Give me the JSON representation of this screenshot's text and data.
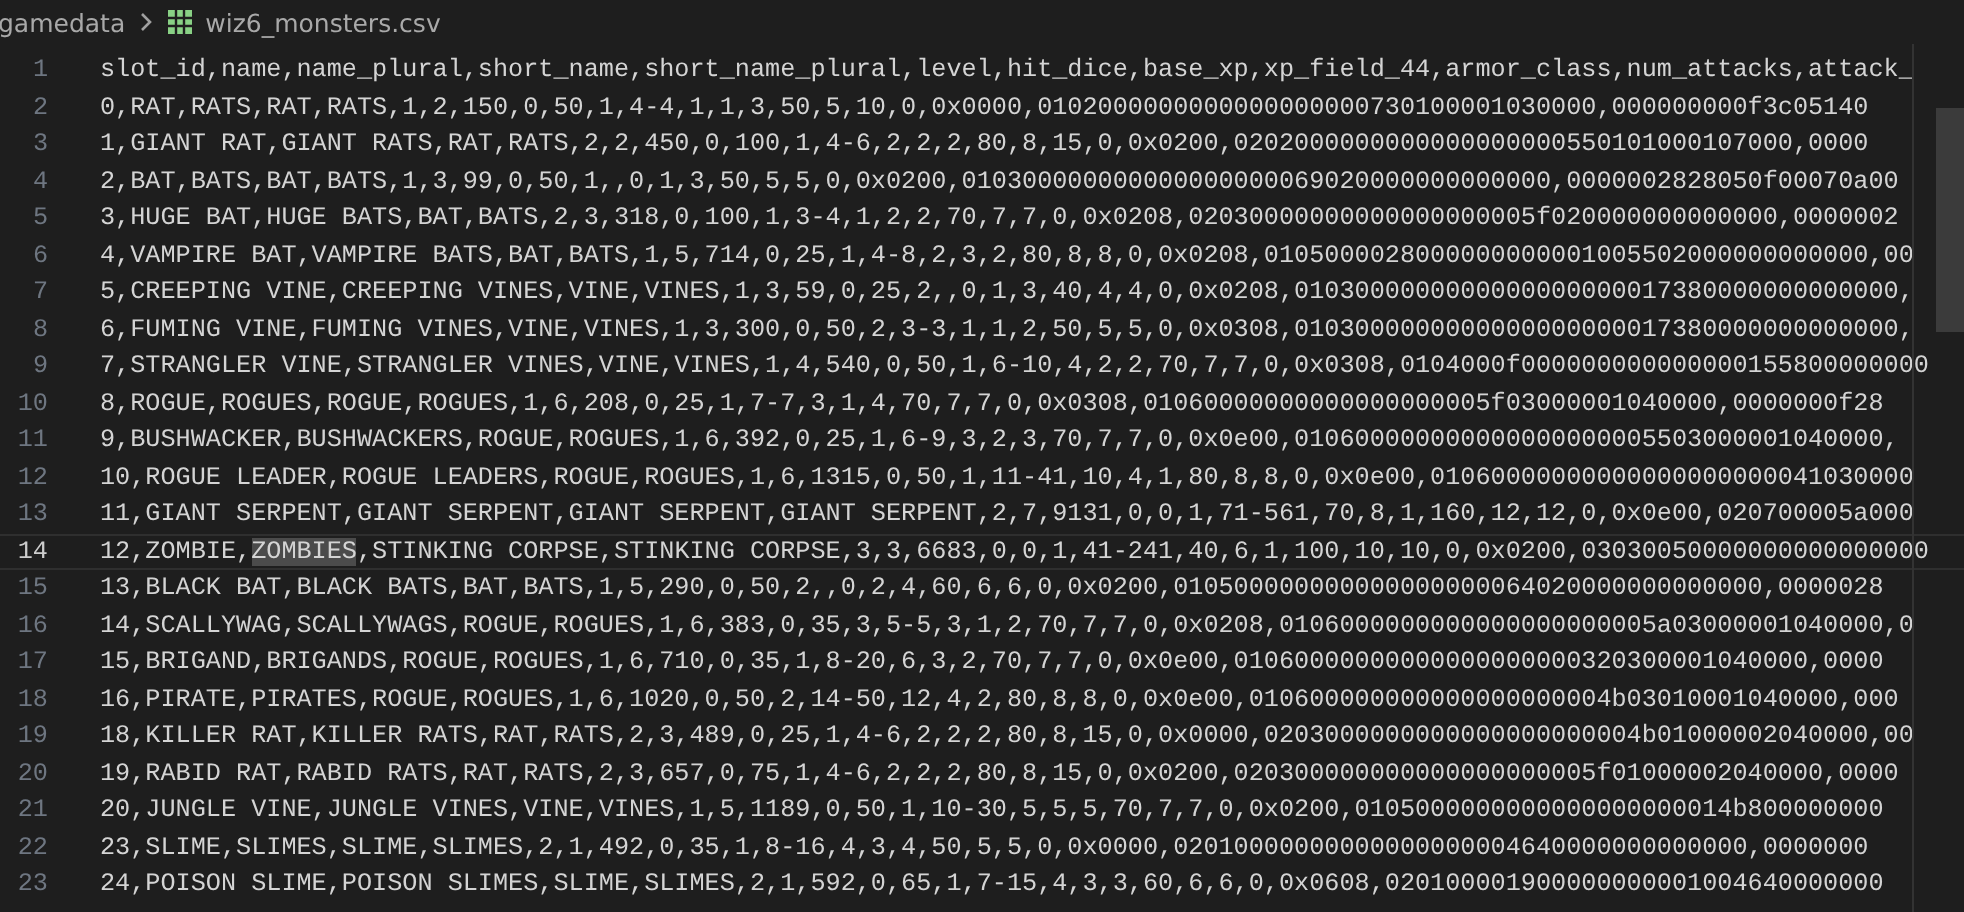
{
  "breadcrumb": {
    "folder": "gamedata",
    "file": "wiz6_monsters.csv"
  },
  "lines": [
    {
      "number": "1",
      "text": "slot_id,name,name_plural,short_name,short_name_plural,level,hit_dice,base_xp,xp_field_44,armor_class,num_attacks,attack_",
      "current": false
    },
    {
      "number": "2",
      "text": "0,RAT,RATS,RAT,RATS,1,2,150,0,50,1,4-4,1,1,3,50,5,10,0,0x0000,0102000000000000000000730100001030000,000000000f3c05140",
      "current": false
    },
    {
      "number": "3",
      "text": "1,GIANT RAT,GIANT RATS,RAT,RATS,2,2,450,0,100,1,4-6,2,2,2,80,8,15,0,0x0200,0202000000000000000000550101000107000,0000",
      "current": false
    },
    {
      "number": "4",
      "text": "2,BAT,BATS,BAT,BATS,1,3,99,0,50,1,,0,1,3,50,5,5,0,0x0200,010300000000000000000069020000000000000,0000002828050f00070a00",
      "current": false
    },
    {
      "number": "5",
      "text": "3,HUGE BAT,HUGE BATS,BAT,BATS,2,3,318,0,100,1,3-4,1,2,2,70,7,7,0,0x0208,02030000000000000000005f020000000000000,0000002",
      "current": false
    },
    {
      "number": "6",
      "text": "4,VAMPIRE BAT,VAMPIRE BATS,BAT,BATS,1,5,714,0,25,1,4-8,2,3,2,80,8,8,0,0x0208,0105000028000000000001005502000000000000,00",
      "current": false
    },
    {
      "number": "7",
      "text": "5,CREEPING VINE,CREEPING VINES,VINE,VINES,1,3,59,0,25,2,,0,1,3,40,4,4,0,0x0208,0103000000000000000000017380000000000000,",
      "current": false
    },
    {
      "number": "8",
      "text": "6,FUMING VINE,FUMING VINES,VINE,VINES,1,3,300,0,50,2,3-3,1,1,2,50,5,5,0,0x0308,0103000000000000000000017380000000000000,",
      "current": false
    },
    {
      "number": "9",
      "text": "7,STRANGLER VINE,STRANGLER VINES,VINE,VINES,1,4,540,0,50,1,6-10,4,2,2,70,7,7,0,0x0308,0104000f000000000000000155800000000",
      "current": false
    },
    {
      "number": "10",
      "text": "8,ROGUE,ROGUES,ROGUE,ROGUES,1,6,208,0,25,1,7-7,3,1,4,70,7,7,0,0x0308,01060000000000000000005f03000001040000,0000000f28",
      "current": false
    },
    {
      "number": "11",
      "text": "9,BUSHWACKER,BUSHWACKERS,ROGUE,ROGUES,1,6,392,0,25,1,6-9,3,2,3,70,7,7,0,0x0e00,010600000000000000000005503000001040000,",
      "current": false
    },
    {
      "number": "12",
      "text": "10,ROGUE LEADER,ROGUE LEADERS,ROGUE,ROGUES,1,6,1315,0,50,1,11-41,10,4,1,80,8,8,0,0x0e00,01060000000000000000000041030000",
      "current": false
    },
    {
      "number": "13",
      "text": "11,GIANT SERPENT,GIANT SERPENT,GIANT SERPENT,GIANT SERPENT,2,7,9131,0,0,1,71-561,70,8,1,160,12,12,0,0x0e00,020700005a000",
      "current": false
    },
    {
      "number": "14",
      "parts": [
        {
          "text": "12,ZOMBIE,",
          "selected": false
        },
        {
          "text": "ZOMBIES",
          "selected": true
        },
        {
          "text": ",STINKING CORPSE,STINKING CORPSE,3,3,6683,0,0,1,41-241,40,6,1,100,10,10,0,0x0200,03030050000000000000000",
          "selected": false
        }
      ],
      "current": true
    },
    {
      "number": "15",
      "text": "13,BLACK BAT,BLACK BATS,BAT,BATS,1,5,290,0,50,2,,0,2,4,60,6,6,0,0x0200,010500000000000000000064020000000000000,0000028",
      "current": false
    },
    {
      "number": "16",
      "text": "14,SCALLYWAG,SCALLYWAGS,ROGUE,ROGUES,1,6,383,0,35,3,5-5,3,1,2,70,7,7,0,0x0208,0106000000000000000000005a03000001040000,0",
      "current": false
    },
    {
      "number": "17",
      "text": "15,BRIGAND,BRIGANDS,ROGUE,ROGUES,1,6,710,0,35,1,8-20,6,3,2,70,7,7,0,0x0e00,01060000000000000000000320300001040000,0000",
      "current": false
    },
    {
      "number": "18",
      "text": "16,PIRATE,PIRATES,ROGUE,ROGUES,1,6,1020,0,50,2,14-50,12,4,2,80,8,8,0,0x0e00,010600000000000000000004b03010001040000,000",
      "current": false
    },
    {
      "number": "19",
      "text": "18,KILLER RAT,KILLER RATS,RAT,RATS,2,3,489,0,25,1,4-6,2,2,2,80,8,15,0,0x0000,0203000000000000000000004b01000002040000,00",
      "current": false
    },
    {
      "number": "20",
      "text": "19,RABID RAT,RABID RATS,RAT,RATS,2,3,657,0,75,1,4-6,2,2,2,80,8,15,0,0x0200,020300000000000000000005f01000002040000,0000",
      "current": false
    },
    {
      "number": "21",
      "text": "20,JUNGLE VINE,JUNGLE VINES,VINE,VINES,1,5,1189,0,50,1,10-30,5,5,5,70,7,7,0,0x0200,0105000000000000000000014b800000000",
      "current": false
    },
    {
      "number": "22",
      "text": "23,SLIME,SLIMES,SLIME,SLIMES,2,1,492,0,35,1,8-16,4,3,4,50,5,5,0,0x0000,02010000000000000000004640000000000000,0000000",
      "current": false
    },
    {
      "number": "23",
      "text": "24,POISON SLIME,POISON SLIMES,SLIME,SLIMES,2,1,592,0,65,1,7-15,4,3,3,60,6,6,0,0x0608,020100001900000000001004640000000",
      "current": false
    }
  ]
}
